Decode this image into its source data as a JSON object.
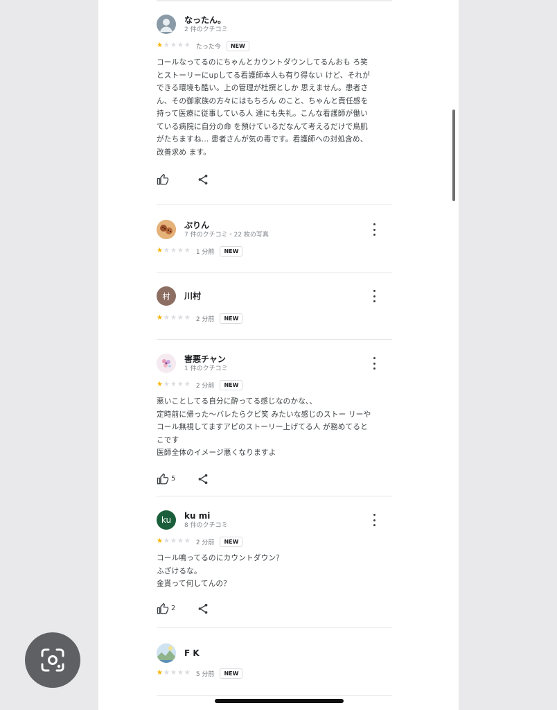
{
  "reviews": [
    {
      "name": "なったん。",
      "sub": "2 件のクチコミ",
      "rating": 1,
      "time": "たった今",
      "badge": "NEW",
      "text": "コールなってるのにちゃんとカウントダウンしてるんおも ろ笑 とストーリーにupしてる看護師本人も有り得ない けど、それができる環境も酷い。上の管理が杜撰としか 思えません。患者さん、その御家族の方々にはもちろん のこと、ちゃんと責任感を持って医療に従事している人 達にも失礼。こんな看護師が働いている病院に自分の命 を預けているだなんて考えるだけで鳥肌がたちますね... 患者さんが気の毒です。看護師への対処含め、改善求め ます。",
      "likes": "",
      "avatar_type": "person-icon"
    },
    {
      "name": "ぷりん",
      "sub": "7 件のクチコミ・22 枚の写真",
      "rating": 1,
      "time": "1 分前",
      "badge": "NEW",
      "text": "",
      "likes": "",
      "avatar_type": "photo-cookie"
    },
    {
      "name": "川村",
      "sub": "",
      "rating": 1,
      "time": "2 分前",
      "badge": "NEW",
      "text": "",
      "likes": "",
      "avatar_type": "letter",
      "avatar_letter": "村"
    },
    {
      "name": "害悪チャン",
      "sub": "1 件のクチコミ",
      "rating": 1,
      "time": "2 分前",
      "badge": "NEW",
      "text": "悪いことしてる自分に酔ってる感じなのかな、、\n定時前に帰った〜バレたらクビ笑 みたいな感じのストー リーやコール無視してますアピのストーリー上げてる人 が務めてるとこです\n医師全体のイメージ悪くなりますよ",
      "likes": "5",
      "avatar_type": "photo-flower"
    },
    {
      "name": "ku mi",
      "sub": "8 件のクチコミ",
      "rating": 1,
      "time": "2 分前",
      "badge": "NEW",
      "text": "コール鳴ってるのにカウントダウン？\nふざけるな。\n金貰って何してんの？",
      "likes": "2",
      "avatar_type": "letter",
      "avatar_letter": "ku"
    },
    {
      "name": "F K",
      "sub": "",
      "rating": 1,
      "time": "5 分前",
      "badge": "NEW",
      "text": "",
      "likes": "",
      "avatar_type": "photo-landscape"
    }
  ],
  "colors": {
    "star_on": "#f6b400",
    "star_off": "#dadce0",
    "avatar_kawamura": "#8d6e63",
    "avatar_kumi": "#1b5e3b"
  },
  "icons": [
    "person-icon",
    "more-vert-icon",
    "star-icon",
    "thumb-up-icon",
    "share-icon",
    "lens-icon"
  ]
}
